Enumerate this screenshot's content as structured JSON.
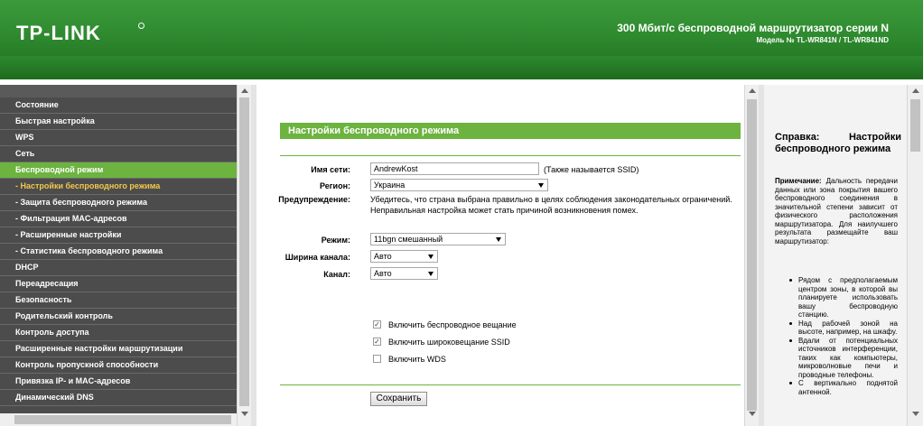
{
  "header": {
    "logo": "TP-LINK",
    "title": "300 Мбит/с беспроводной маршрутизатор серии N",
    "model": "Модель № TL-WR841N / TL-WR841ND"
  },
  "sidebar": {
    "items": [
      {
        "label": "Состояние",
        "state": "normal"
      },
      {
        "label": "Быстрая настройка",
        "state": "normal"
      },
      {
        "label": "WPS",
        "state": "normal"
      },
      {
        "label": "Сеть",
        "state": "normal"
      },
      {
        "label": "Беспроводной режим",
        "state": "active"
      },
      {
        "label": "- Настройки беспроводного режима",
        "state": "sub-active"
      },
      {
        "label": "- Защита беспроводного режима",
        "state": "normal"
      },
      {
        "label": "- Фильтрация MAC-адресов",
        "state": "normal"
      },
      {
        "label": "- Расширенные настройки",
        "state": "normal"
      },
      {
        "label": "- Статистика беспроводного режима",
        "state": "normal"
      },
      {
        "label": "DHCP",
        "state": "normal"
      },
      {
        "label": "Переадресация",
        "state": "normal"
      },
      {
        "label": "Безопасность",
        "state": "normal"
      },
      {
        "label": "Родительский контроль",
        "state": "normal"
      },
      {
        "label": "Контроль доступа",
        "state": "normal"
      },
      {
        "label": "Расширенные настройки маршрутизации",
        "state": "normal"
      },
      {
        "label": "Контроль пропускной способности",
        "state": "normal"
      },
      {
        "label": "Привязка IP- и MAC-адресов",
        "state": "normal"
      },
      {
        "label": "Динамический DNS",
        "state": "normal"
      }
    ]
  },
  "main": {
    "section_title": "Настройки беспроводного режима",
    "ssid_label": "Имя сети:",
    "ssid_value": "AndrewKost",
    "ssid_hint": "(Также называется SSID)",
    "region_label": "Регион:",
    "region_value": "Украина",
    "warning_label": "Предупреждение:",
    "warning_line1": "Убедитесь, что страна выбрана правильно в целях соблюдения законодательных ограничений.",
    "warning_line2": "Неправильная настройка может стать причиной возникновения помех.",
    "mode_label": "Режим:",
    "mode_value": "11bgn смешанный",
    "width_label": "Ширина канала:",
    "width_value": "Авто",
    "channel_label": "Канал:",
    "channel_value": "Авто",
    "checkboxes": [
      {
        "label": "Включить беспроводное вещание",
        "checked": true
      },
      {
        "label": "Включить широковещание SSID",
        "checked": true
      },
      {
        "label": "Включить WDS",
        "checked": false
      }
    ],
    "save_button": "Сохранить"
  },
  "help": {
    "title": "Справка: Настройки беспроводного режима",
    "note_bold": "Примечание:",
    "note_text": "Дальность передачи данных или зона покрытия вашего беспроводного соединения в значительной степени зависит от физического расположения маршрутизатора. Для наилучшего результата размещайте ваш маршрутизатор:",
    "bullets": [
      "Рядом с предполагаемым центром зоны, в которой вы планируете использовать вашу беспроводную станцию.",
      "Над рабочей зоной на высоте, например, на шкафу.",
      "Вдали от потенциальных источников интерференции, таких как компьютеры, микроволновые печи и проводные телефоны.",
      "С вертикально поднятой антенной."
    ]
  }
}
